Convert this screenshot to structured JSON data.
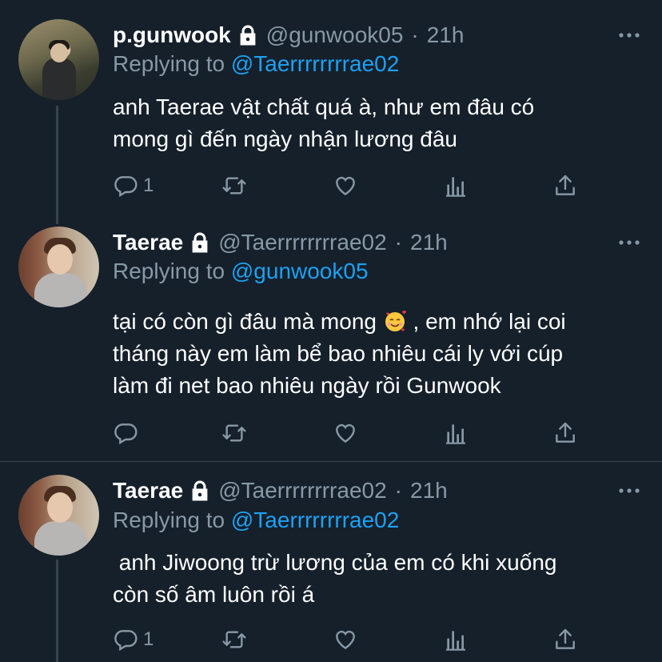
{
  "tweets": [
    {
      "display_name": "p.gunwook",
      "handle": "@gunwook05",
      "dot": "·",
      "time": "21h",
      "replying_prefix": "Replying to ",
      "replying_to": "@Taerrrrrrrrae02",
      "text_lines": [
        "anh Taerae vật chất quá à, như em đâu có",
        "mong gì đến ngày nhận lương đâu"
      ],
      "reply_count": "1",
      "retweet_count": "",
      "like_count": ""
    },
    {
      "display_name": "Taerae",
      "handle": "@Taerrrrrrrrae02",
      "dot": "·",
      "time": "21h",
      "replying_prefix": "Replying to ",
      "replying_to": "@gunwook05",
      "text_lines": [
        "tại có còn gì đâu mà mong",
        " , em nhớ lại coi",
        "tháng này em làm bể bao nhiêu cái ly với cúp",
        "làm đi net bao nhiêu ngày rồi Gunwook"
      ],
      "reply_count": "",
      "retweet_count": "",
      "like_count": ""
    },
    {
      "display_name": "Taerae",
      "handle": "@Taerrrrrrrrae02",
      "dot": "·",
      "time": "21h",
      "replying_prefix": "Replying to ",
      "replying_to": "@Taerrrrrrrrae02",
      "text_lines": [
        " anh Jiwoong trừ lương của em có khi xuống",
        "còn số âm luôn rồi á"
      ],
      "reply_count": "1",
      "retweet_count": "",
      "like_count": ""
    }
  ],
  "icons": {
    "lock": "lock-icon",
    "more": "more-icon",
    "reply": "reply-icon",
    "retweet": "retweet-icon",
    "like": "heart-icon",
    "analytics": "analytics-icon",
    "share": "share-icon",
    "emoji": "smiling-face-with-hearts-emoji"
  },
  "colors": {
    "background": "#15202b",
    "secondary_text": "#8899a6",
    "link": "#1da1f2",
    "divider": "#38444d"
  }
}
